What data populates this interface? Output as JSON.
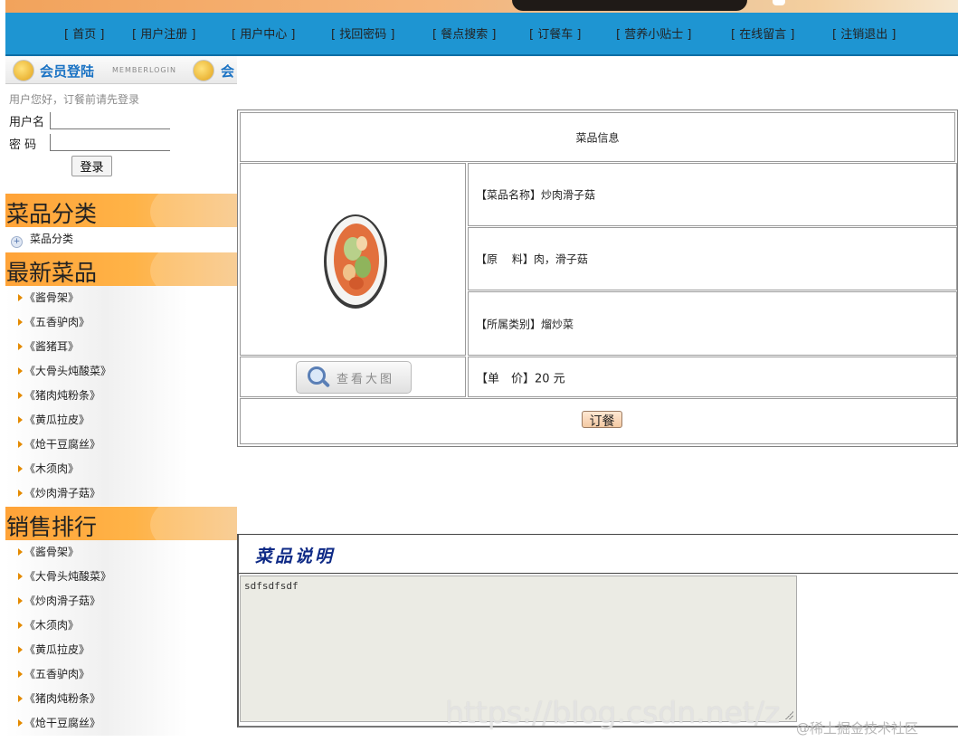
{
  "nav": {
    "items": [
      "首页",
      "用户注册",
      "用户中心",
      "找回密码",
      "餐点搜索",
      "订餐车",
      "营养小贴士",
      "在线留言",
      "注销退出"
    ]
  },
  "member": {
    "title": "会员登陆",
    "subtitle": "MEMBERLOGIN",
    "title_repeat": "会"
  },
  "login": {
    "tip": "用户您好，订餐前请先登录",
    "username_label": "用户名",
    "password_label": "密 码",
    "username_value": "",
    "password_value": "",
    "button": "登录"
  },
  "sidebar": {
    "category_header": "菜品分类",
    "category_item": "菜品分类",
    "latest_header": "最新菜品",
    "latest": [
      "《酱骨架》",
      "《五香驴肉》",
      "《酱猪耳》",
      "《大骨头炖酸菜》",
      "《猪肉炖粉条》",
      "《黄瓜拉皮》",
      "《炝干豆腐丝》",
      "《木须肉》",
      "《炒肉滑子菇》"
    ],
    "ranking_header": "销售排行",
    "ranking": [
      "《酱骨架》",
      "《大骨头炖酸菜》",
      "《炒肉滑子菇》",
      "《木须肉》",
      "《黄瓜拉皮》",
      "《五香驴肉》",
      "《猪肉炖粉条》",
      "《炝干豆腐丝》"
    ]
  },
  "dish": {
    "header": "菜品信息",
    "name": "【菜品名称】炒肉滑子菇",
    "ingredients": "【原　 料】肉，滑子菇",
    "category": "【所属类别】熘炒菜",
    "price": "【单　价】20 元",
    "zoom_button": "查看大图",
    "order_button": "订餐"
  },
  "description": {
    "title": "菜品说明",
    "text": "sdfsdfsdf"
  },
  "watermarks": {
    "main": "https://blog.csdn.net/z",
    "corner": "@稀土掘金技术社区"
  },
  "colors": {
    "nav_bg": "#1e95d2",
    "section_header": "#ffa338",
    "title_blue": "#0e2a86",
    "order_button": "#f3c9a3"
  }
}
